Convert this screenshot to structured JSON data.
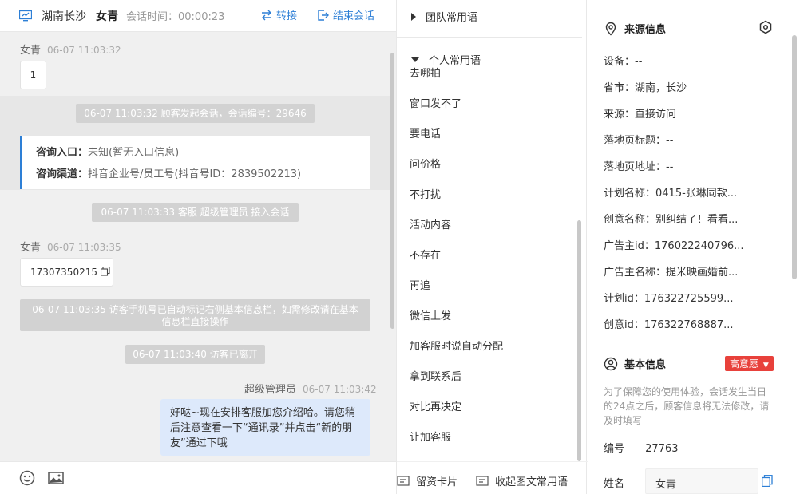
{
  "header": {
    "location": "湖南长沙",
    "customer": "女青",
    "session_time": "会话时间：00:00:23",
    "transfer_label": "转接",
    "end_label": "结束会话"
  },
  "messages": {
    "visitor_name": "女青",
    "msg1_time": "06-07 11:03:32",
    "msg1_text": "1",
    "sys1": "06-07 11:03:32 顾客发起会话，会话编号：29646",
    "card_entry_label": "咨询入口：",
    "card_entry_value": "未知(暂无入口信息)",
    "card_channel_label": "咨询渠道：",
    "card_channel_value": "抖音企业号/员工号(抖音号ID：2839502213)",
    "sys2": "06-07 11:03:33 客服 超级管理员 接入会话",
    "msg2_time": "06-07 11:03:35",
    "msg2_text": "17307350215",
    "sys3": "06-07 11:03:35 访客手机号已自动标记右侧基本信息栏，如需修改请在基本信息栏直接操作",
    "sys4": "06-07 11:03:40 访客已离开",
    "agent_name": "超级管理员",
    "msg3_time": "06-07 11:03:42",
    "msg3_text": "好哒~现在安排客服加您介绍哈。请您稍后注意查看一下“通讯录”并点击“新的朋友”通过下哦"
  },
  "phrases": {
    "team_group": "团队常用语",
    "personal_group": "个人常用语",
    "items": [
      "去哪拍",
      "窗口发不了",
      "要电话",
      "问价格",
      "不打扰",
      "活动内容",
      "不存在",
      "再追",
      "微信上发",
      "加客服时说自动分配",
      "拿到联系后",
      "对比再决定",
      "让加客服"
    ],
    "footer_card": "留资卡片",
    "footer_collapse": "收起图文常用语"
  },
  "source_info": {
    "title": "来源信息",
    "rows": [
      {
        "label": "设备：",
        "value": "--"
      },
      {
        "label": "省市：",
        "value": "湖南，长沙"
      },
      {
        "label": "来源：",
        "value": "直接访问"
      },
      {
        "label": "落地页标题：",
        "value": "--"
      },
      {
        "label": "落地页地址：",
        "value": "--"
      },
      {
        "label": "计划名称：",
        "value": "0415-张琳同款..."
      },
      {
        "label": "创意名称：",
        "value": "别纠结了！看看..."
      },
      {
        "label": "广告主id：",
        "value": "176022240796..."
      },
      {
        "label": "广告主名称：",
        "value": "提米映画婚前..."
      },
      {
        "label": "计划id：",
        "value": "176322725599..."
      },
      {
        "label": "创意id：",
        "value": "176322768887..."
      }
    ]
  },
  "basic_info": {
    "title": "基本信息",
    "tag": "高意愿",
    "note": "为了保障您的使用体验，会话发生当日的24点之后，顾客信息将无法修改，请及时填写",
    "id_label": "编号",
    "id_value": "27763",
    "name_label": "姓名",
    "name_value": "女青"
  },
  "colors": {
    "accent": "#2d7fd6",
    "tag_red": "#e8413b",
    "agent_bubble": "#dde9fb"
  }
}
